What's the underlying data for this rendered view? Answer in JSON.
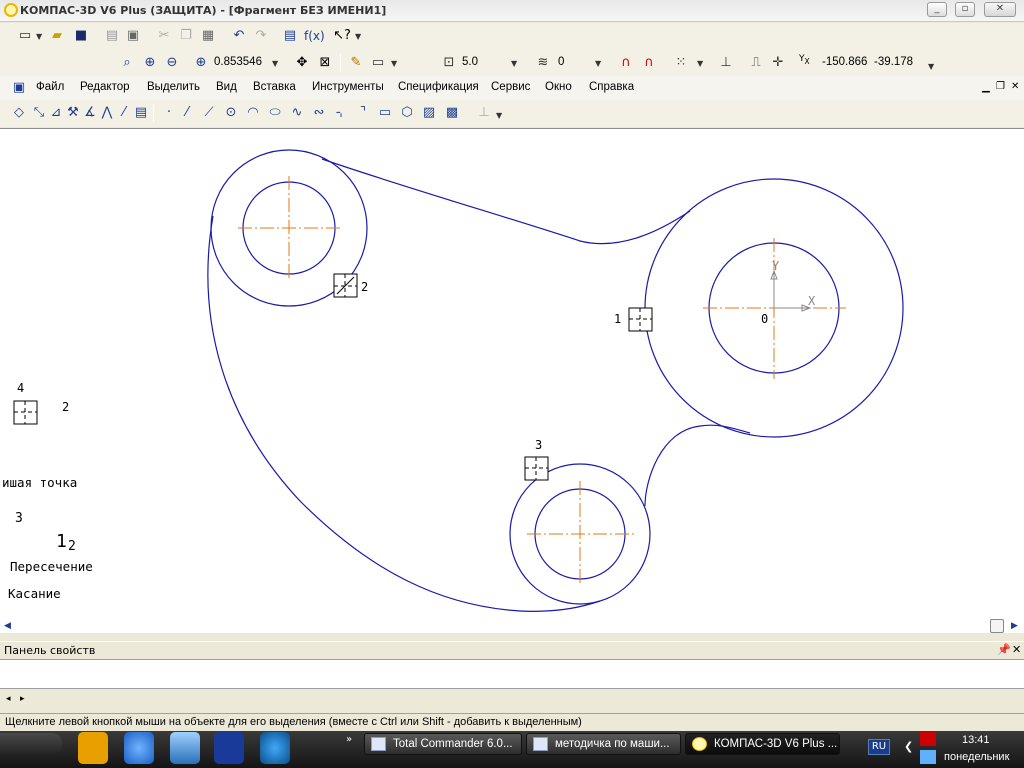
{
  "window": {
    "title": "КОМПАС-3D V6 Plus (ЗАЩИТА) - [Фрагмент БЕЗ ИМЕНИ1]"
  },
  "toolbar": {
    "zoom_value": "0.853546",
    "step_value": "5.0",
    "layer_value": "0",
    "coord_x": "-150.866",
    "coord_y": "-39.178",
    "fx_label": "f(x)"
  },
  "menu": {
    "items": [
      "Файл",
      "Редактор",
      "Выделить",
      "Вид",
      "Вставка",
      "Инструменты",
      "Спецификация",
      "Сервис",
      "Окно",
      "Справка"
    ]
  },
  "canvas": {
    "snap_labels": {
      "snap1": "1",
      "snap2": "2",
      "snap3": "3",
      "origin": "0",
      "axis_y": "Y",
      "axis_x": "X"
    },
    "legend": {
      "num4": "4",
      "num2": "2",
      "nearest_point": "ишая точка",
      "num3": "3",
      "num1": "1",
      "sub2": "2",
      "intersection": "Пересечение",
      "tangency": "Касание"
    }
  },
  "panels": {
    "properties_title": "Панель свойств"
  },
  "status": {
    "hint": "Щелкните левой кнопкой мыши на объекте для его выделения (вместе с Ctrl или Shift - добавить к выделенным)"
  },
  "taskbar": {
    "tasks": [
      "Total Commander 6.0...",
      "методичка по маши...",
      "КОМПАС-3D V6 Plus ..."
    ],
    "lang": "RU",
    "time": "13:41",
    "day": "понедельник"
  },
  "colors": {
    "contour": "#1a1aa8",
    "axis": "#e07a10",
    "canvas_bg": "#ffffff"
  }
}
